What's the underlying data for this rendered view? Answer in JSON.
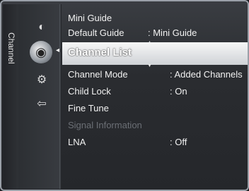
{
  "side_tab": {
    "label": "Channel"
  },
  "icons": [
    {
      "name": "picture-icon",
      "glyph": "◐"
    },
    {
      "name": "sound-icon",
      "glyph": "◉"
    },
    {
      "name": "setup-gear-icon",
      "glyph": "⚙"
    },
    {
      "name": "input-icon",
      "glyph": "⇦"
    }
  ],
  "menu": {
    "mini_guide": "Mini Guide",
    "default_guide": "Default Guide",
    "default_guide_value": ": Mini Guide",
    "channel_list": "Channel List",
    "channel_mode": "Channel Mode",
    "channel_mode_value": ": Added Channels",
    "child_lock": "Child Lock",
    "child_lock_value": ": On",
    "fine_tune": "Fine Tune",
    "signal_information": "Signal Information",
    "lna": "LNA",
    "lna_value": ": Off"
  }
}
